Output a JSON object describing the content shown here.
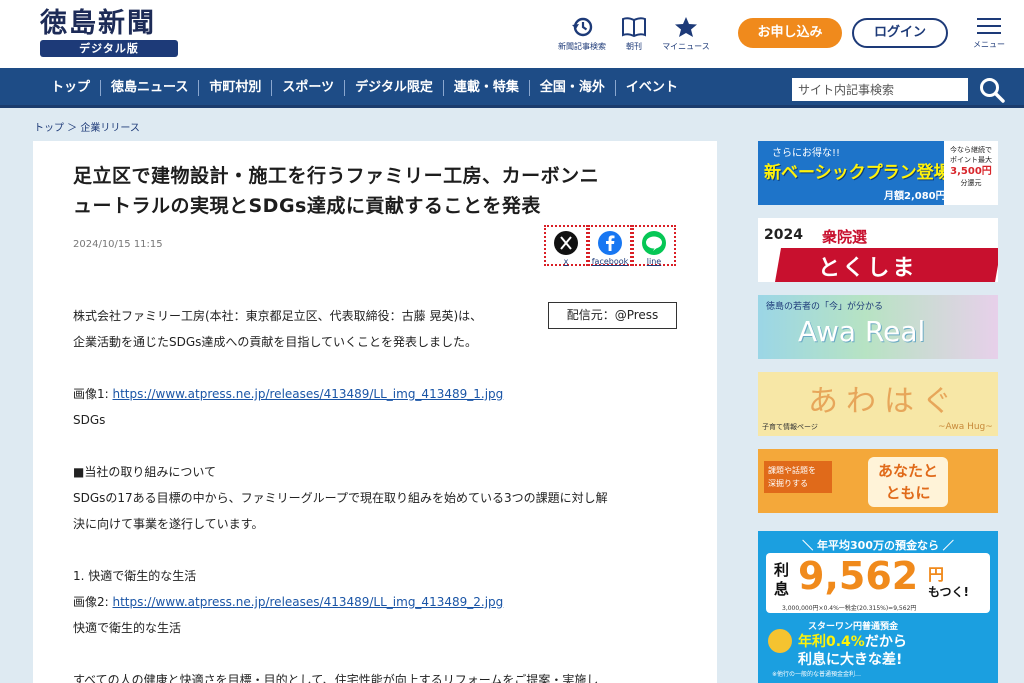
{
  "header": {
    "logo_main": "徳島新聞",
    "logo_sub": "デジタル版",
    "icons": [
      {
        "name": "history-icon",
        "label": "新聞記事検索"
      },
      {
        "name": "book-icon",
        "label": "朝刊"
      },
      {
        "name": "star-icon",
        "label": "マイニュース"
      }
    ],
    "apply_label": "お申し込み",
    "login_label": "ログイン",
    "menu_label": "メニュー"
  },
  "nav": {
    "items": [
      "トップ",
      "徳島ニュース",
      "市町村別",
      "スポーツ",
      "デジタル限定",
      "連載・特集",
      "全国・海外",
      "イベント"
    ],
    "search_placeholder": "サイト内記事検索"
  },
  "breadcrumb": "トップ ＞ 企業リリース",
  "article": {
    "title_line1": "足立区で建物設計・施工を行うファミリー工房、カーボンニ",
    "title_line2": "ュートラルの実現とSDGs達成に貢献することを発表",
    "date": "2024/10/15 11:15",
    "share": [
      {
        "name": "x",
        "label": "x"
      },
      {
        "name": "facebook",
        "label": "facebook"
      },
      {
        "name": "line",
        "label": "line"
      }
    ],
    "source": "配信元：@Press",
    "lines": [
      {
        "text": "株式会社ファミリー工房(本社：東京都足立区、代表取締役：古藤 晃英)は、"
      },
      {
        "text": "企業活動を通じたSDGs達成への貢献を目指していくことを発表しました。"
      },
      {
        "text": ""
      },
      {
        "prefix": "画像1: ",
        "link": "https://www.atpress.ne.jp/releases/413489/LL_img_413489_1.jpg"
      },
      {
        "text": "SDGs"
      },
      {
        "text": ""
      },
      {
        "text": "■当社の取り組みについて"
      },
      {
        "text": "SDGsの17ある目標の中から、ファミリーグループで現在取り組みを始めている3つの課題に対し解"
      },
      {
        "text": "決に向けて事業を遂行しています。"
      },
      {
        "text": ""
      },
      {
        "text": "1. 快適で衛生的な生活"
      },
      {
        "prefix": "画像2: ",
        "link": "https://www.atpress.ne.jp/releases/413489/LL_img_413489_2.jpg"
      },
      {
        "text": "快適で衛生的な生活"
      },
      {
        "text": ""
      },
      {
        "text": "すべての人の健康と快適さを目標・目的として、住宅性能が向上するリフォームをご提案・実施し"
      }
    ]
  },
  "sidebar": {
    "ad1": {
      "small": "さらにお得な!!",
      "main": "新ベーシックプラン登場!!",
      "price": "月額2,080円",
      "badge_l1": "今なら継続で",
      "badge_l2": "ポイント最大",
      "badge_l3": "3,500円",
      "badge_l4": "分還元"
    },
    "ad2": {
      "year": "2024",
      "title": "衆院選",
      "sub": "とくしま"
    },
    "ad3": {
      "small": "徳島の若者の「今」が分かる",
      "main": "Awa Real"
    },
    "ad4": {
      "main": "あわはぐ",
      "small": "子育て情報ページ",
      "sub": "~Awa Hug~"
    },
    "ad5": {
      "left1": "課題や話題を",
      "left2": "深掘りする",
      "right1": "あなたと",
      "right2": "ともに"
    },
    "ad6": {
      "top": "＼ 年平均300万の預金なら ／",
      "left": "利息",
      "amount": "9,562",
      "unit": "円",
      "tail": "もつく!",
      "fine": "3,000,000円×0.4%一税金(20.315%)=9,562円",
      "bank": "スターワン円普通預金",
      "rate": "年利0.4%",
      "rate_tail": "だから",
      "big": "利息に大きな差!",
      "note": "※他行の一般的な普通預金金利…"
    }
  },
  "colors": {
    "nav": "#1e4c86",
    "accent": "#f08a1c",
    "brand": "#1d3a78",
    "link": "#1a55a6"
  }
}
